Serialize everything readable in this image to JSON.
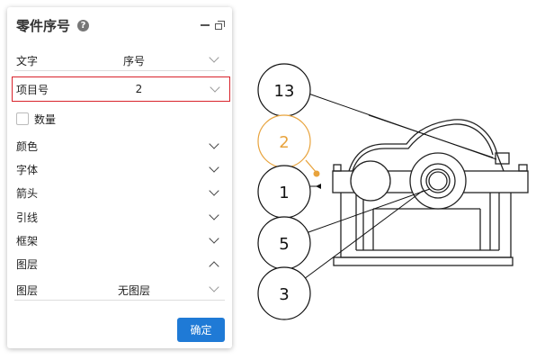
{
  "panel": {
    "title": "零件序号",
    "help_icon": "?",
    "rows": {
      "text": {
        "label": "文字",
        "value": "序号"
      },
      "item": {
        "label": "项目号",
        "value": "2"
      },
      "quantity": {
        "label": "数量"
      },
      "color": {
        "label": "颜色"
      },
      "font": {
        "label": "字体"
      },
      "arrow": {
        "label": "箭头"
      },
      "leader": {
        "label": "引线"
      },
      "frame": {
        "label": "框架"
      },
      "layer_section": {
        "label": "图层"
      },
      "layer": {
        "label": "图层",
        "value": "无图层"
      }
    },
    "ok_label": "确定"
  },
  "balloons": [
    {
      "label": "13"
    },
    {
      "label": "2"
    },
    {
      "label": "1"
    },
    {
      "label": "5"
    },
    {
      "label": "3"
    }
  ],
  "colors": {
    "accent": "#1f7ad6",
    "highlight": "#d9232b",
    "selected_balloon": "#e8a33c"
  }
}
